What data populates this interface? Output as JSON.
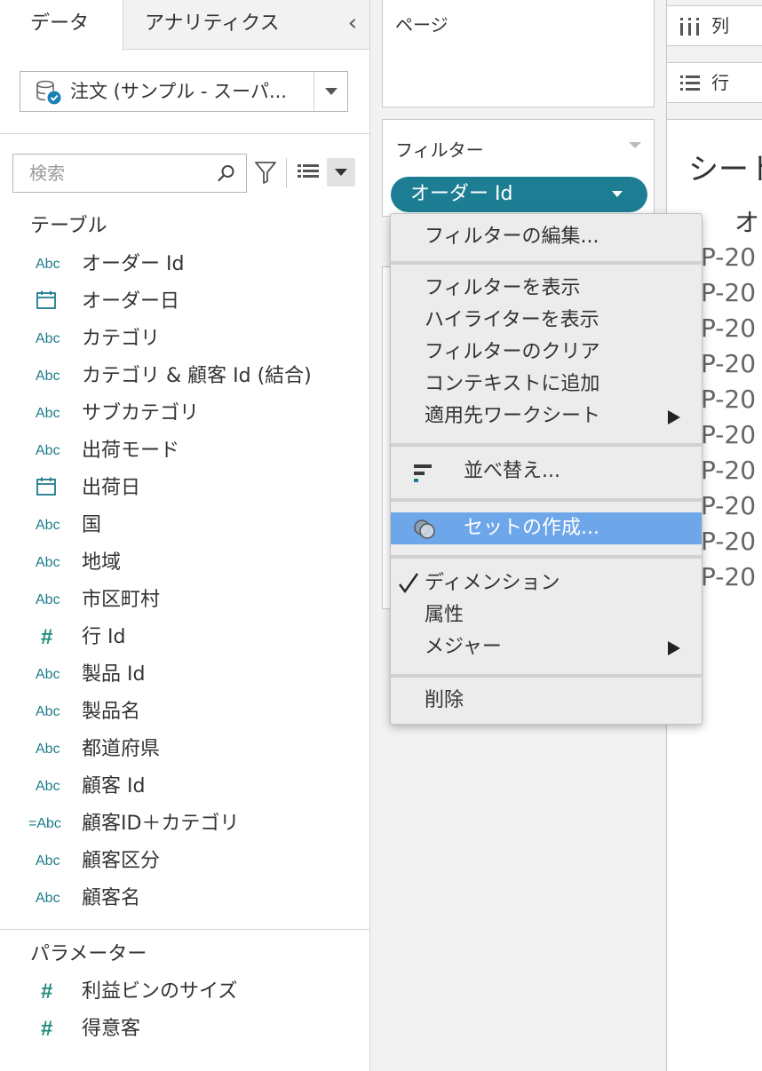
{
  "data_pane": {
    "tabs": {
      "data": "データ",
      "analytics": "アナリティクス"
    },
    "collapse": "‹",
    "datasource": "注文 (サンプル - スーパ...",
    "search_placeholder": "検索",
    "tables_title": "テーブル",
    "fields": [
      {
        "type": "Abc",
        "label": "オーダー Id"
      },
      {
        "type": "date",
        "label": "オーダー日"
      },
      {
        "type": "Abc",
        "label": "カテゴリ"
      },
      {
        "type": "Abc",
        "label": "カテゴリ & 顧客 Id (結合)"
      },
      {
        "type": "Abc",
        "label": "サブカテゴリ"
      },
      {
        "type": "Abc",
        "label": "出荷モード"
      },
      {
        "type": "date",
        "label": "出荷日"
      },
      {
        "type": "Abc",
        "label": "国"
      },
      {
        "type": "Abc",
        "label": "地域"
      },
      {
        "type": "Abc",
        "label": "市区町村"
      },
      {
        "type": "#",
        "label": "行 Id"
      },
      {
        "type": "Abc",
        "label": "製品 Id"
      },
      {
        "type": "Abc",
        "label": "製品名"
      },
      {
        "type": "Abc",
        "label": "都道府県"
      },
      {
        "type": "Abc",
        "label": "顧客 Id"
      },
      {
        "type": "=Abc",
        "label": "顧客ID＋カテゴリ"
      },
      {
        "type": "Abc",
        "label": "顧客区分"
      },
      {
        "type": "Abc",
        "label": "顧客名"
      }
    ],
    "parameters_title": "パラメーター",
    "parameters": [
      {
        "type": "#",
        "label": "利益ビンのサイズ"
      },
      {
        "type": "#",
        "label": "得意客"
      }
    ]
  },
  "shelves": {
    "pages": "ページ",
    "filters": "フィルター",
    "filter_pill": "オーダー Id",
    "columns": "列",
    "rows": "行"
  },
  "sheet": {
    "title": "シート",
    "column_header": "オ",
    "row_values": [
      "P-20",
      "P-20",
      "P-20",
      "P-20",
      "P-20",
      "P-20",
      "P-20",
      "P-20",
      "P-20",
      "P-20"
    ]
  },
  "context_menu": {
    "edit_filter": "フィルターの編集...",
    "show_filter": "フィルターを表示",
    "show_highlighter": "ハイライターを表示",
    "clear_filter": "フィルターのクリア",
    "add_to_context": "コンテキストに追加",
    "apply_to_worksheets": "適用先ワークシート",
    "sort": "並べ替え...",
    "create_set": "セットの作成...",
    "dimension": "ディメンション",
    "attribute": "属性",
    "measure": "メジャー",
    "remove": "削除"
  },
  "colors": {
    "accent_teal": "#1d7e93",
    "menu_highlight": "#6ea6ea"
  }
}
